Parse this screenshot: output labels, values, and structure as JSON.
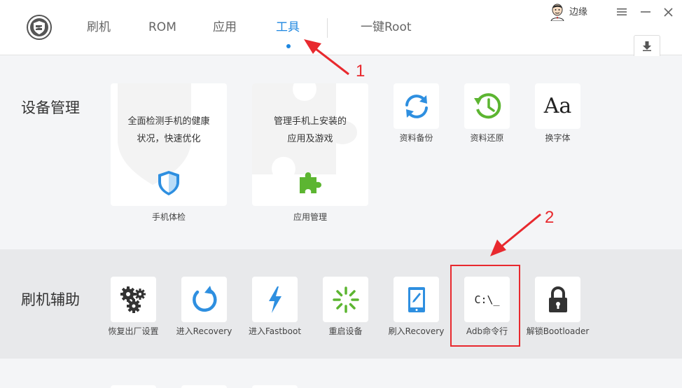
{
  "header": {
    "tabs": [
      {
        "label": "刷机"
      },
      {
        "label": "ROM"
      },
      {
        "label": "应用"
      },
      {
        "label": "工具",
        "active": true
      },
      {
        "label": "一键Root"
      }
    ],
    "user": {
      "name": "边缘"
    }
  },
  "sections": {
    "device_management": {
      "title": "设备管理",
      "big_cards": [
        {
          "desc_line1": "全面检测手机的健康",
          "desc_line2": "状况，快速优化",
          "label": "手机体检",
          "icon": "shield-icon"
        },
        {
          "desc_line1": "管理手机上安装的",
          "desc_line2": "应用及游戏",
          "label": "应用管理",
          "icon": "puzzle-icon"
        }
      ],
      "tiles": [
        {
          "label": "资料备份",
          "icon": "sync-icon",
          "color": "#2e8fe0"
        },
        {
          "label": "资料还原",
          "icon": "history-icon",
          "color": "#5cb531"
        },
        {
          "label": "换字体",
          "icon": "font-icon",
          "glyph": "Aa"
        }
      ]
    },
    "flash_assist": {
      "title": "刷机辅助",
      "tiles": [
        {
          "label": "恢复出厂设置",
          "icon": "gears-icon"
        },
        {
          "label": "进入Recovery",
          "icon": "refresh-icon"
        },
        {
          "label": "进入Fastboot",
          "icon": "lightning-icon"
        },
        {
          "label": "重启设备",
          "icon": "loading-icon"
        },
        {
          "label": "刷入Recovery",
          "icon": "tablet-icon"
        },
        {
          "label": "Adb命令行",
          "icon": "terminal-icon",
          "glyph": "C:\\_"
        },
        {
          "label": "解锁Bootloader",
          "icon": "lock-icon"
        }
      ]
    }
  },
  "annotations": {
    "first": "1",
    "second": "2",
    "color": "#e8292e"
  },
  "colors": {
    "accent": "#1e87e0",
    "green": "#5cb531",
    "blue": "#2e8fe0"
  }
}
